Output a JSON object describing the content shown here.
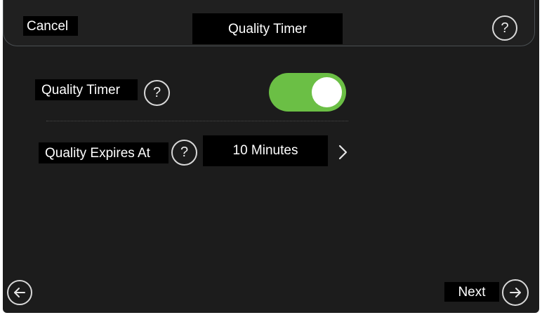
{
  "header": {
    "cancel_label": "Cancel",
    "title": "Quality Timer",
    "help_icon": "question-circle-icon"
  },
  "settings": {
    "quality_timer": {
      "label": "Quality Timer",
      "help_icon": "question-circle-icon",
      "enabled": true
    },
    "expires_at": {
      "label": "Quality Expires At",
      "help_icon": "question-circle-icon",
      "value": "10 Minutes",
      "chevron_icon": "chevron-right-icon"
    }
  },
  "footer": {
    "back_icon": "arrow-left-circle-icon",
    "next_label": "Next",
    "next_icon": "arrow-right-circle-icon"
  },
  "colors": {
    "background": "#1c1c1c",
    "toggle_on": "#6bbf45",
    "text": "#ffffff"
  }
}
